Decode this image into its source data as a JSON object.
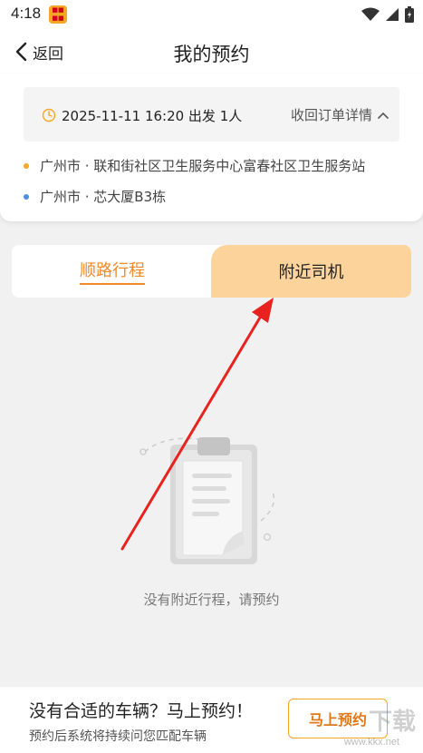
{
  "status_bar": {
    "time": "4:18",
    "icons": [
      "wifi-icon",
      "signal-icon",
      "battery-icon"
    ]
  },
  "header": {
    "back_label": "返回",
    "title": "我的预约"
  },
  "order": {
    "depart_text": "2025-11-11 16:20 出发 1人",
    "collapse_label": "收回订单详情",
    "origin": "广州市 · 联和街社区卫生服务中心富春社区卫生服务站",
    "destination": "广州市 · 芯大厦B3栋",
    "origin_color": "#f5a623",
    "destination_color": "#4a90e2"
  },
  "tabs": {
    "route_label": "顺路行程",
    "drivers_label": "附近司机",
    "active_color": "#f08a2a",
    "drivers_bg": "#fdd39c"
  },
  "empty_state": {
    "message": "没有附近行程，请预约"
  },
  "bottom": {
    "title": "没有合适的车辆？马上预约！",
    "subtitle": "预约后系统将持续问您匹配车辆",
    "book_label": "马上预约"
  },
  "watermark": {
    "text": "下载",
    "url": "www.kkx.net"
  }
}
